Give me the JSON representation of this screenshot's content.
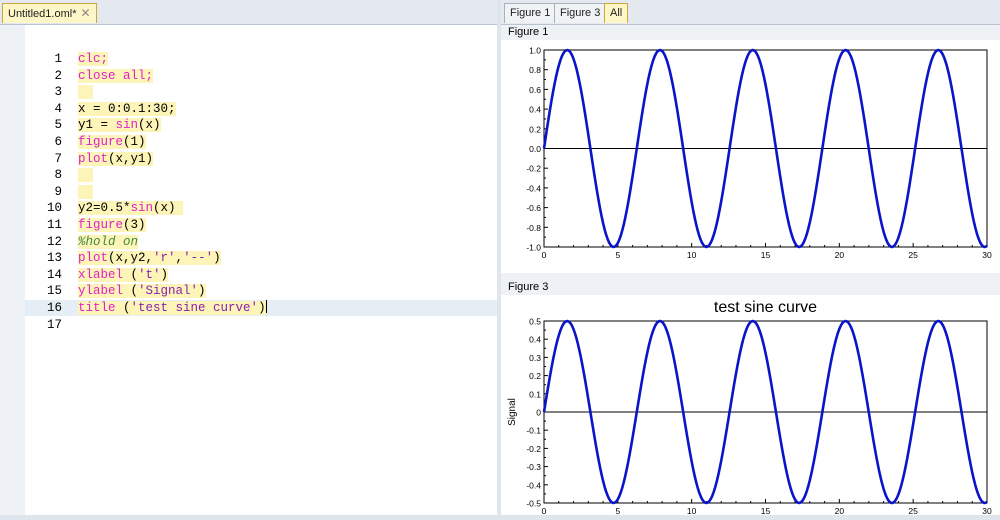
{
  "editor_tab": {
    "label": "Untitled1.oml*",
    "close": "✕"
  },
  "figure_tabs": [
    {
      "label": "Figure 1",
      "active": false
    },
    {
      "label": "Figure 3",
      "active": false
    },
    {
      "label": "All",
      "active": true
    }
  ],
  "editor": {
    "current_line": 16,
    "lines": [
      {
        "n": "1",
        "tokens": [
          {
            "t": "clc;",
            "c": "k"
          }
        ]
      },
      {
        "n": "2",
        "tokens": [
          {
            "t": "close all;",
            "c": "k"
          }
        ]
      },
      {
        "n": "3",
        "tokens": [
          {
            "t": "  ",
            "c": ""
          }
        ]
      },
      {
        "n": "4",
        "tokens": [
          {
            "t": "x = 0:0.1:30;",
            "c": ""
          }
        ]
      },
      {
        "n": "5",
        "tokens": [
          {
            "t": "y1 = ",
            "c": ""
          },
          {
            "t": "sin",
            "c": "k"
          },
          {
            "t": "(x)",
            "c": ""
          }
        ]
      },
      {
        "n": "6",
        "tokens": [
          {
            "t": "figure",
            "c": "k"
          },
          {
            "t": "(1)",
            "c": ""
          }
        ]
      },
      {
        "n": "7",
        "tokens": [
          {
            "t": "plot",
            "c": "k"
          },
          {
            "t": "(x,y1)",
            "c": ""
          }
        ]
      },
      {
        "n": "8",
        "tokens": [
          {
            "t": "  ",
            "c": ""
          }
        ]
      },
      {
        "n": "9",
        "tokens": [
          {
            "t": "  ",
            "c": ""
          }
        ]
      },
      {
        "n": "10",
        "tokens": [
          {
            "t": "y2=0.5*",
            "c": ""
          },
          {
            "t": "sin",
            "c": "k"
          },
          {
            "t": "(x) ",
            "c": ""
          }
        ]
      },
      {
        "n": "11",
        "tokens": [
          {
            "t": "figure",
            "c": "k"
          },
          {
            "t": "(3)",
            "c": ""
          }
        ]
      },
      {
        "n": "12",
        "tokens": [
          {
            "t": "%hold on",
            "c": "c"
          }
        ]
      },
      {
        "n": "13",
        "tokens": [
          {
            "t": "plot",
            "c": "k"
          },
          {
            "t": "(x,y2,",
            "c": ""
          },
          {
            "t": "'r'",
            "c": "s"
          },
          {
            "t": ",",
            "c": ""
          },
          {
            "t": "'--'",
            "c": "s"
          },
          {
            "t": ")",
            "c": ""
          }
        ]
      },
      {
        "n": "14",
        "tokens": [
          {
            "t": "xlabel ",
            "c": "k"
          },
          {
            "t": "(",
            "c": ""
          },
          {
            "t": "'t'",
            "c": "s"
          },
          {
            "t": ")",
            "c": ""
          }
        ]
      },
      {
        "n": "15",
        "tokens": [
          {
            "t": "ylabel ",
            "c": "k"
          },
          {
            "t": "(",
            "c": ""
          },
          {
            "t": "'Signal'",
            "c": "s"
          },
          {
            "t": ")",
            "c": ""
          }
        ]
      },
      {
        "n": "16",
        "tokens": [
          {
            "t": "title ",
            "c": "k"
          },
          {
            "t": "(",
            "c": ""
          },
          {
            "t": "'test sine curve'",
            "c": "s"
          },
          {
            "t": ")",
            "c": ""
          }
        ]
      },
      {
        "n": "17",
        "tokens": []
      }
    ]
  },
  "figures": {
    "fig1": {
      "label": "Figure 1"
    },
    "fig3": {
      "label": "Figure 3"
    }
  },
  "chart_data": [
    {
      "type": "line",
      "figure": "Figure 1",
      "title": "",
      "xlabel": "",
      "ylabel": "",
      "function": "sin(x)",
      "x_range": [
        0,
        30
      ],
      "x_step": 0.1,
      "xlim": [
        0,
        30
      ],
      "ylim": [
        -1,
        1
      ],
      "xticks": [
        "0",
        "5",
        "10",
        "15",
        "20",
        "25",
        "30"
      ],
      "yticks": [
        "1.0",
        "0.8",
        "0.6",
        "0.4",
        "0.2",
        "0.0",
        "-0.2",
        "-0.4",
        "-0.6",
        "-0.8",
        "-1.0"
      ],
      "series": [
        {
          "amplitude": 1.0,
          "color": "#0a14c8"
        }
      ],
      "zero_line": true,
      "grid": false
    },
    {
      "type": "line",
      "figure": "Figure 3",
      "title": "test sine curve",
      "xlabel": "",
      "ylabel": "Signal",
      "function": "0.5*sin(x)",
      "x_range": [
        0,
        30
      ],
      "x_step": 0.1,
      "xlim": [
        0,
        30
      ],
      "ylim": [
        -0.5,
        0.5
      ],
      "xticks": [
        "0",
        "5",
        "10",
        "15",
        "20",
        "25",
        "30"
      ],
      "yticks": [
        "0.5",
        "0.4",
        "0.3",
        "0.2",
        "0.1",
        "0",
        "-0.1",
        "-0.2",
        "-0.3",
        "-0.4",
        "-0.5"
      ],
      "series": [
        {
          "amplitude": 0.5,
          "color": "#0a14c8"
        }
      ],
      "zero_line": true,
      "grid": false
    }
  ]
}
